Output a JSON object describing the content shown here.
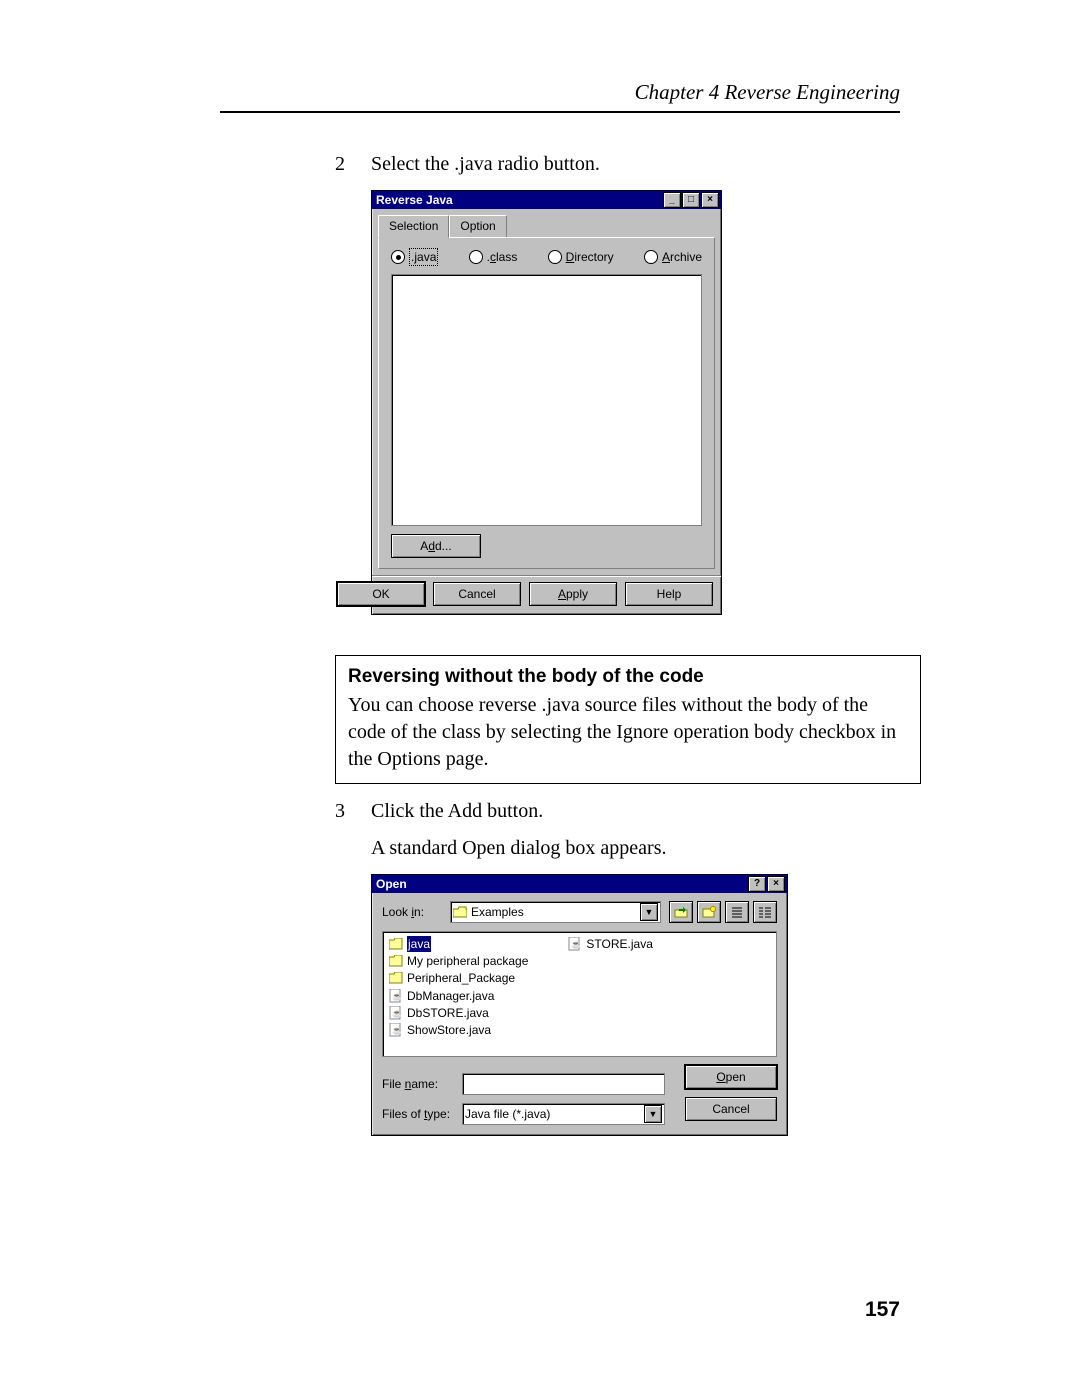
{
  "header": {
    "chapter": "Chapter 4  Reverse Engineering"
  },
  "steps": {
    "n2": "2",
    "t2": "Select the .java radio button.",
    "n3": "3",
    "t3": "Click the Add button.",
    "t3b": "A standard Open dialog box appears."
  },
  "callout": {
    "title": "Reversing without the body of the code",
    "text": "You can choose reverse .java source files without the body of the code of the class by selecting the Ignore operation body checkbox in the Options page."
  },
  "pagenum": "157",
  "dlg1": {
    "title": "Reverse Java",
    "tabs": {
      "selection": "Selection",
      "option": "Option"
    },
    "radios": {
      "java": ".java",
      "class": ".class",
      "directory": "Directory",
      "archive": "Archive"
    },
    "add": "Add...",
    "ok": "OK",
    "cancel": "Cancel",
    "apply": "Apply",
    "help": "Help"
  },
  "dlg2": {
    "title": "Open",
    "lookin_label": "Look in:",
    "lookin_value": "Examples",
    "files": {
      "c1": [
        "java",
        "My peripheral package",
        "Peripheral_Package",
        "DbManager.java",
        "DbSTORE.java",
        "ShowStore.java"
      ],
      "c2": [
        "STORE.java"
      ]
    },
    "filename_label": "File name:",
    "filetype_label": "Files of type:",
    "filetype_value": "Java file (*.java)",
    "open": "Open",
    "cancel": "Cancel"
  }
}
